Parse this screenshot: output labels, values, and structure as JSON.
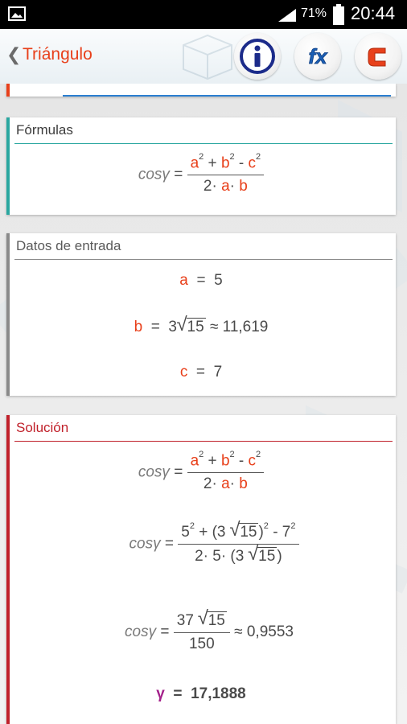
{
  "status": {
    "battery_pct": "71%",
    "time": "20:44"
  },
  "appbar": {
    "title": "Triángulo",
    "icons": [
      "info-icon",
      "fx-icon",
      "calculator-icon"
    ]
  },
  "formulas": {
    "heading": "Fórmulas",
    "lhs": "cosγ",
    "num": [
      "a",
      "2",
      " + ",
      "b",
      "2",
      " - ",
      "c",
      "2"
    ],
    "den": [
      "2· ",
      "a",
      "· ",
      "b"
    ]
  },
  "inputs": {
    "heading": "Datos de entrada",
    "a_label": "a",
    "a_eq": "=",
    "a_val": "5",
    "b_label": "b",
    "b_eq": "=",
    "b_val_coef": "3",
    "b_val_rad": "15",
    "b_approx": "≈ 11,619",
    "c_label": "c",
    "c_eq": "=",
    "c_val": "7"
  },
  "solution": {
    "heading": "Solución",
    "step1_lhs": "cosγ",
    "step2_lhs": "cosγ",
    "step2_num": {
      "a": "5",
      "e1": "2",
      "plus": " + (3 ",
      "rad": "15",
      "close": ")",
      "e2": "2",
      "minus": " - 7",
      "e3": "2"
    },
    "step2_den": {
      "pre": "2· 5· (3 ",
      "rad": "15",
      "close": ")"
    },
    "step3_lhs": "cosγ",
    "step3_num_coef": "37 ",
    "step3_num_rad": "15",
    "step3_den": "150",
    "step3_approx": "≈ 0,9553",
    "result_label": "γ",
    "result_eq": "=",
    "result_val": "17,1888"
  },
  "colors": {
    "accent": "#e8401b",
    "formulas_bar": "#2aa7a0",
    "inputs_bar": "#8a8a8a",
    "solution_bar": "#c0202a",
    "gamma": "#a3208a"
  }
}
